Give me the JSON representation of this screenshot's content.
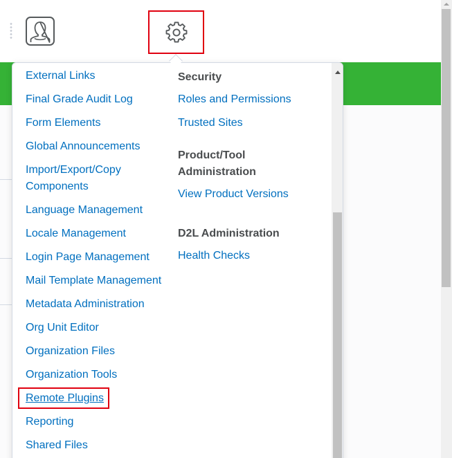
{
  "header": {
    "avatar_icon": "user-avatar-icon",
    "settings_icon": "gear-icon",
    "drag_handle_icon": "drag-dots-icon"
  },
  "colors": {
    "navbar": "#35b236",
    "link": "#006fbf",
    "heading": "#494c4e",
    "highlight": "#e0000f"
  },
  "admin_menu": {
    "left_column": [
      {
        "label": "External Links"
      },
      {
        "label": "Final Grade Audit Log"
      },
      {
        "label": "Form Elements"
      },
      {
        "label": "Global Announcements"
      },
      {
        "label": "Import/Export/Copy Components"
      },
      {
        "label": "Language Management"
      },
      {
        "label": "Locale Management"
      },
      {
        "label": "Login Page Management"
      },
      {
        "label": "Mail Template Management"
      },
      {
        "label": "Metadata Administration"
      },
      {
        "label": "Org Unit Editor"
      },
      {
        "label": "Organization Files"
      },
      {
        "label": "Organization Tools"
      },
      {
        "label": "Remote Plugins",
        "highlighted": true
      },
      {
        "label": "Reporting"
      },
      {
        "label": "Shared Files"
      }
    ],
    "right_column": [
      {
        "heading": "Security",
        "links": [
          "Roles and Permissions",
          "Trusted Sites"
        ]
      },
      {
        "heading": "Product/Tool Administration",
        "links": [
          "View Product Versions"
        ]
      },
      {
        "heading": "D2L Administration",
        "links": [
          "Health Checks"
        ]
      }
    ]
  }
}
